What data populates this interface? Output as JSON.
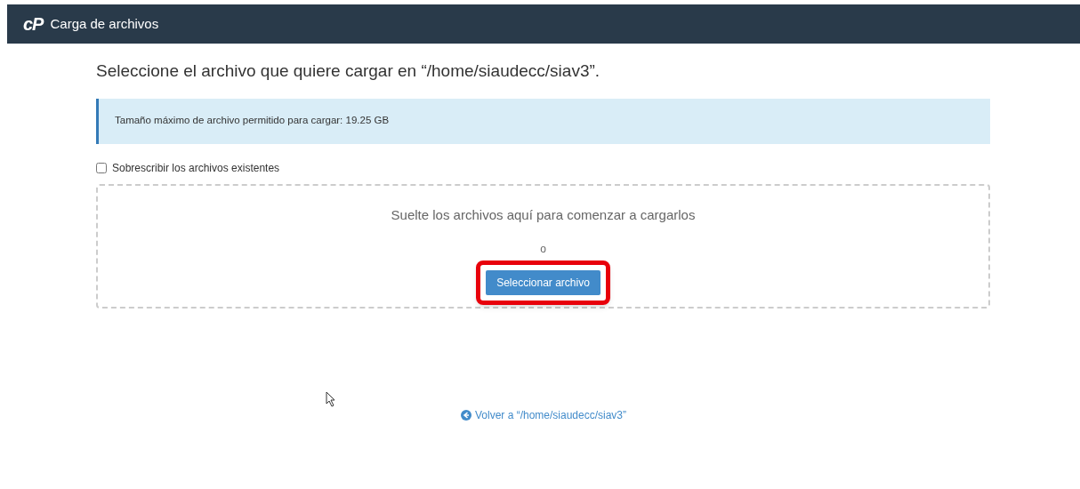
{
  "header": {
    "logo": "cP",
    "title": "Carga de archivos"
  },
  "heading": "Seleccione el archivo que quiere cargar en “/home/siaudecc/siav3”.",
  "info": "Tamaño máximo de archivo permitido para cargar: 19.25 GB",
  "overwrite": {
    "label": "Sobrescribir los archivos existentes",
    "checked": false
  },
  "dropzone": {
    "prompt": "Suelte los archivos aquí para comenzar a cargarlos",
    "separator": "o",
    "button": "Seleccionar archivo",
    "highlighted": true
  },
  "back_link": "Volver a “/home/siaudecc/siav3”"
}
